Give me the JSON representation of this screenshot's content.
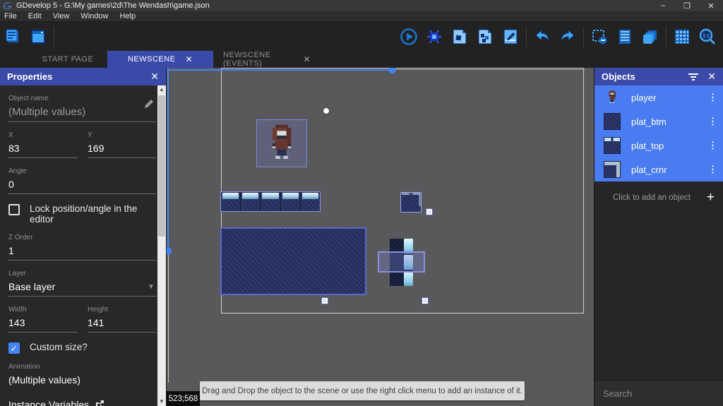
{
  "window": {
    "title": "GDevelop 5 - G:\\My games\\2d\\The Wendash\\game.json",
    "controls": {
      "minimize": "–",
      "restore": "❐",
      "close": "✕"
    }
  },
  "menu": {
    "items": [
      "File",
      "Edit",
      "View",
      "Window",
      "Help"
    ]
  },
  "toolbar": {
    "zoom_ratio": "1:1"
  },
  "tabs": [
    {
      "label": "START PAGE",
      "close": ""
    },
    {
      "label": "NEWSCENE",
      "close": "✕"
    },
    {
      "label": "NEWSCENE (EVENTS)",
      "close": "✕"
    }
  ],
  "properties": {
    "title": "Properties",
    "close": "✕",
    "object_name_label": "Object name",
    "object_name_value": "(Multiple values)",
    "x_label": "X",
    "x_value": "83",
    "y_label": "Y",
    "y_value": "169",
    "angle_label": "Angle",
    "angle_value": "0",
    "lock_label": "Lock position/angle in the editor",
    "z_order_label": "Z Order",
    "z_order_value": "1",
    "layer_label": "Layer",
    "layer_value": "Base layer",
    "width_label": "Width",
    "width_value": "143",
    "height_label": "Height",
    "height_value": "141",
    "custom_size_label": "Custom size?",
    "custom_size_check": "✓",
    "animation_label": "Animation",
    "animation_value": "(Multiple values)",
    "instance_variables_label": "Instance Variables"
  },
  "canvas": {
    "coords": "523;568",
    "hint": "Drag and Drop the object to the scene or use the right click menu to add an instance of it."
  },
  "objects_panel": {
    "title": "Objects",
    "close": "✕",
    "items": [
      {
        "name": "player"
      },
      {
        "name": "plat_btm"
      },
      {
        "name": "plat_top"
      },
      {
        "name": "plat_crnr"
      }
    ],
    "menu_glyph": "⋮",
    "add_hint": "Click to add an object",
    "add_plus": "+",
    "search_placeholder": "Search"
  },
  "colors": {
    "accent_indigo": "#3b49a8",
    "object_row_blue": "#4a7cf1",
    "scrollbar_blue": "#4285f4",
    "canvas_gray": "#59595b",
    "tile_navy": "#2b3468",
    "hint_bg": "#dcdcdc"
  }
}
